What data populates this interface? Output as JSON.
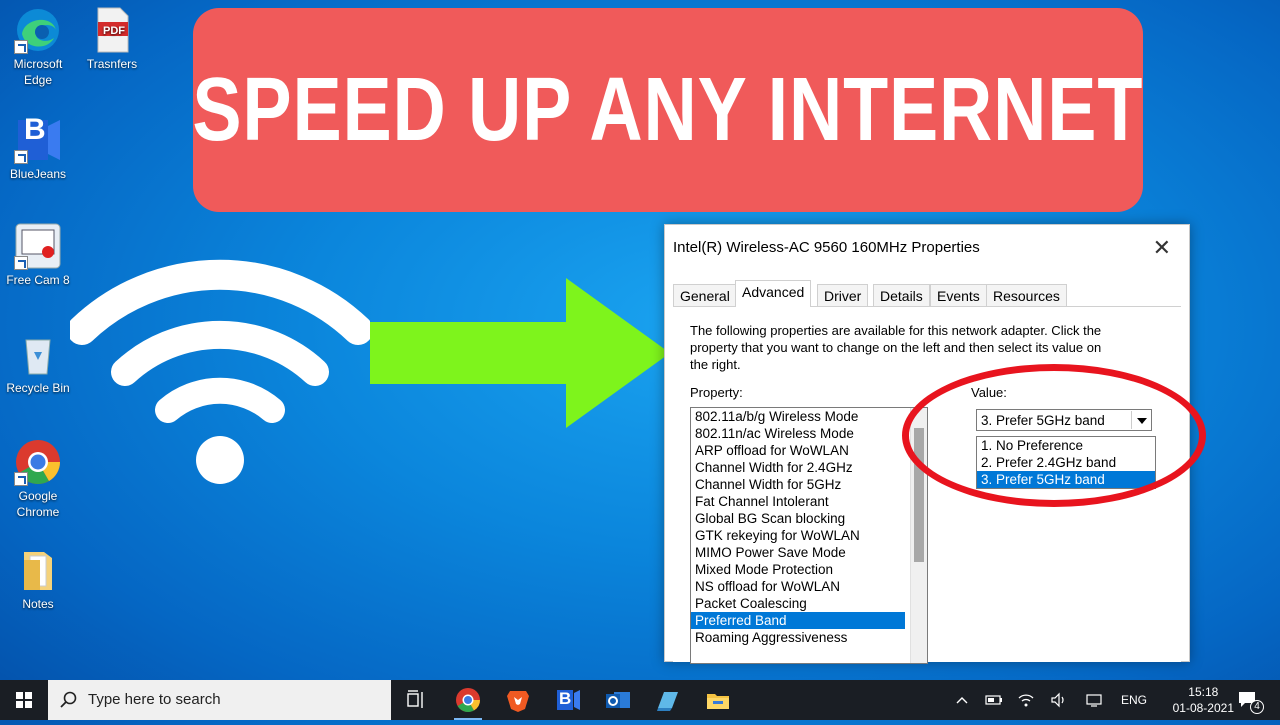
{
  "desktop": {
    "icons": [
      {
        "label": "Microsoft Edge"
      },
      {
        "label": "Trasnfers"
      },
      {
        "label": "BlueJeans"
      },
      {
        "label": "Free Cam 8"
      },
      {
        "label": "Recycle Bin"
      },
      {
        "label": "Google Chrome"
      },
      {
        "label": "Notes"
      }
    ],
    "pdf_badge": "PDF",
    "bluejeans_letter": "B"
  },
  "banner": {
    "text": "SPEED UP ANY INTERNET",
    "color": "#f05a5a"
  },
  "dialog": {
    "title": "Intel(R) Wireless-AC 9560 160MHz Properties",
    "close": "✕",
    "tabs": [
      "General",
      "Advanced",
      "Driver",
      "Details",
      "Events",
      "Resources"
    ],
    "active_tab": "Advanced",
    "description": "The following properties are available for this network adapter. Click the property that you want to change on the left and then select its value on the right.",
    "property_label": "Property:",
    "value_label": "Value:",
    "properties": [
      "802.11a/b/g Wireless Mode",
      "802.11n/ac Wireless Mode",
      "ARP offload for WoWLAN",
      "Channel Width for 2.4GHz",
      "Channel Width for 5GHz",
      "Fat Channel Intolerant",
      "Global BG Scan blocking",
      "GTK rekeying for WoWLAN",
      "MIMO Power Save Mode",
      "Mixed Mode Protection",
      "NS offload for WoWLAN",
      "Packet Coalescing",
      "Preferred Band",
      "Roaming Aggressiveness"
    ],
    "selected_property": "Preferred Band",
    "value_selected": "3. Prefer 5GHz band",
    "value_options": [
      "1. No Preference",
      "2. Prefer 2.4GHz band",
      "3. Prefer 5GHz band"
    ],
    "selection_color": "#0078d7",
    "highlight_ring_color": "#e8141e"
  },
  "taskbar": {
    "search_placeholder": "Type here to search",
    "language": "ENG",
    "time": "15:18",
    "date": "01-08-2021",
    "notification_count": "4",
    "bluejeans_letter": "B"
  },
  "colors": {
    "arrow": "#7ef41c",
    "wifi": "#ffffff",
    "taskbar": "#1a1e24"
  }
}
